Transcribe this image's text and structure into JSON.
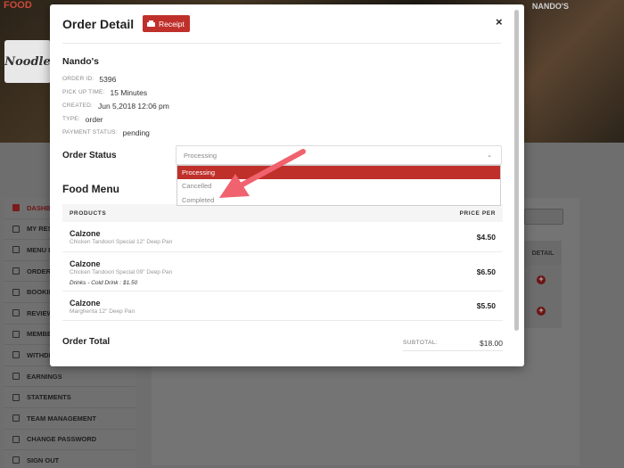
{
  "background": {
    "logo": "FOOD",
    "user_name": "NANDO'S",
    "avatar_text": "Noodle",
    "sidebar": [
      {
        "label": "DASHB",
        "icon": "dashboard-icon",
        "active": true
      },
      {
        "label": "MY REST",
        "icon": "store-icon"
      },
      {
        "label": "MENU B",
        "icon": "menu-icon"
      },
      {
        "label": "ORDERS",
        "icon": "orders-icon"
      },
      {
        "label": "BOOKIN",
        "icon": "booking-icon"
      },
      {
        "label": "REVIEW",
        "icon": "reviews-icon"
      },
      {
        "label": "MEMBE",
        "icon": "members-icon"
      },
      {
        "label": "WITHDR",
        "icon": "withdraw-icon"
      },
      {
        "label": "EARNINGS",
        "icon": "earnings-icon"
      },
      {
        "label": "STATEMENTS",
        "icon": "statements-icon"
      },
      {
        "label": "TEAM MANAGEMENT",
        "icon": "team-icon"
      },
      {
        "label": "CHANGE PASSWORD",
        "icon": "lock-icon"
      },
      {
        "label": "SIGN OUT",
        "icon": "signout-icon"
      }
    ],
    "detail_header": "DETAIL"
  },
  "modal": {
    "title": "Order Detail",
    "receipt_label": "Receipt",
    "close_label": "×",
    "restaurant": "Nando's",
    "meta": [
      {
        "label": "ORDER ID:",
        "value": "5396"
      },
      {
        "label": "PICK UP TIME:",
        "value": "15 Minutes"
      },
      {
        "label": "CREATED:",
        "value": "Jun 5,2018 12:06 pm"
      },
      {
        "label": "TYPE:",
        "value": "order"
      },
      {
        "label": "PAYMENT STATUS:",
        "value": "pending"
      }
    ],
    "order_status": {
      "label": "Order Status",
      "selected": "Processing",
      "options": [
        "Processing",
        "Cancelled",
        "Completed"
      ]
    },
    "food_menu": {
      "title": "Food Menu",
      "col_products": "PRODUCTS",
      "col_price": "PRICE PER",
      "items": [
        {
          "name": "Calzone",
          "desc": "Chicken Tandoori Special 12\" Deep Pan",
          "extra": "",
          "price": "$4.50"
        },
        {
          "name": "Calzone",
          "desc": "Chicken Tandoori Special 09\" Deep Pan",
          "extra": "Drinks - Cold Drink : $1.50",
          "price": "$6.50"
        },
        {
          "name": "Calzone",
          "desc": "Margherita 12\" Deep Pan",
          "extra": "",
          "price": "$5.50"
        }
      ]
    },
    "order_total": {
      "label": "Order Total",
      "subtotal_label": "SUBTOTAL:",
      "subtotal_value": "$18.00"
    }
  },
  "colors": {
    "accent": "#c0302b",
    "annotation_arrow": "#f0626e"
  }
}
